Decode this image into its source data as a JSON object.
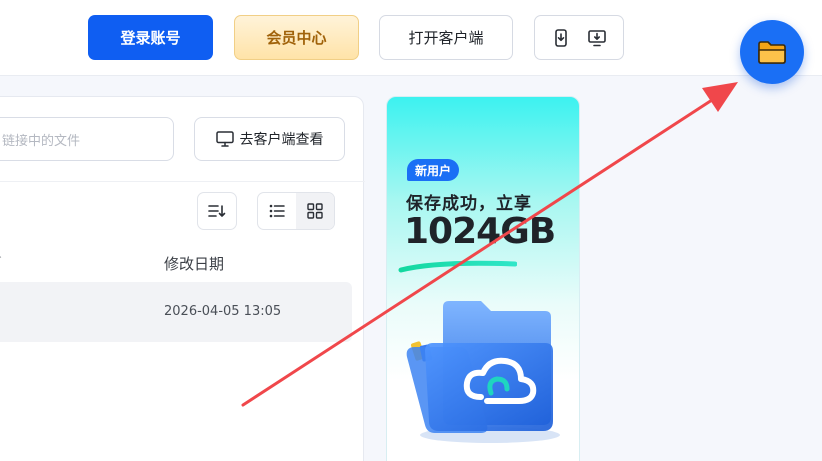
{
  "header": {
    "login_label": "登录账号",
    "vip_label": "会员中心",
    "client_label": "打开客户端",
    "device_icons": [
      "phone-download-icon",
      "desktop-download-icon"
    ]
  },
  "floating": {
    "icon": "folder-icon"
  },
  "panel": {
    "search_placeholder": "链接中的文件",
    "goto_client_label": "去客户端查看",
    "columns": {
      "name_sort_indicator": "^",
      "date": "修改日期"
    },
    "rows": [
      {
        "date": "2026-04-05 13:05"
      }
    ]
  },
  "ad": {
    "badge": "新用户",
    "line1": "保存成功，立享",
    "big": "1024GB"
  },
  "colors": {
    "primary": "#0f5ef2",
    "vip_text": "#a0620a",
    "annotation_arrow": "#f0474b"
  }
}
